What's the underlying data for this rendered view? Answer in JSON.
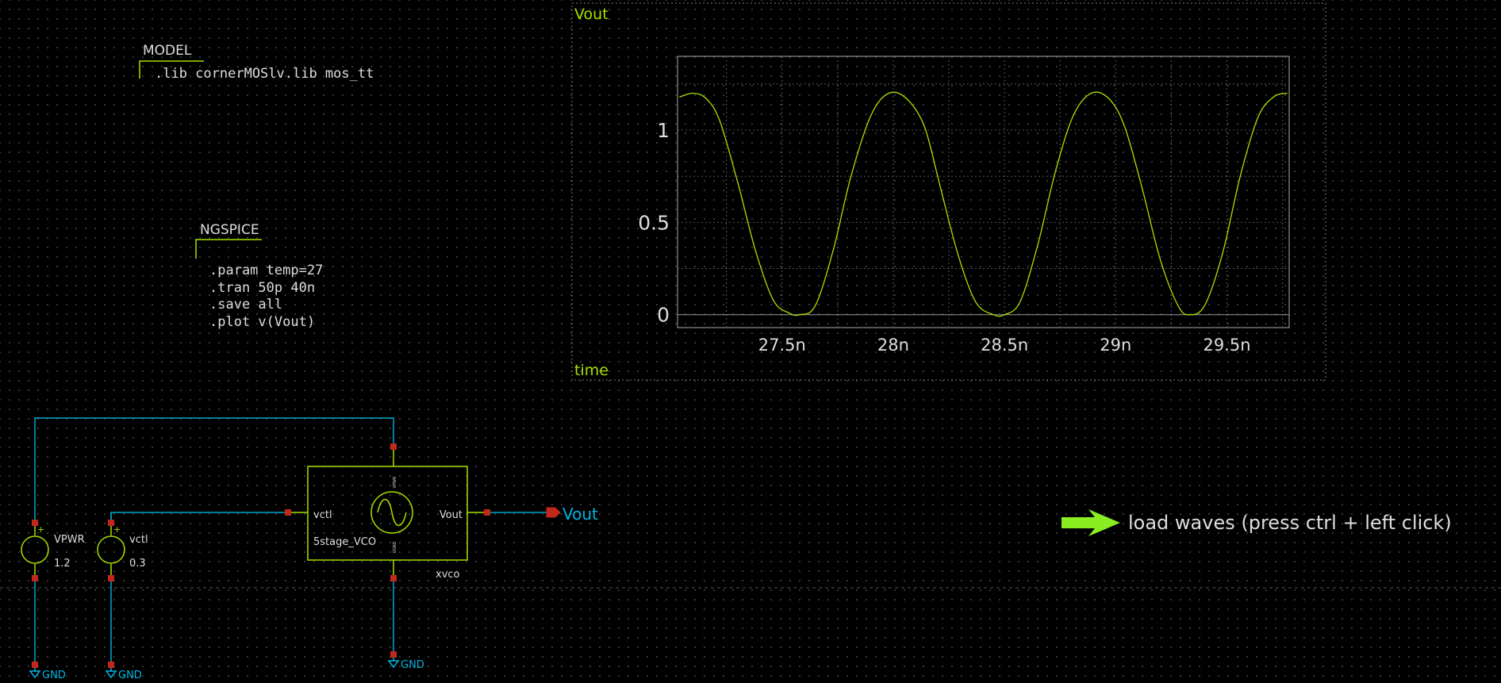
{
  "model_block": {
    "title": "MODEL",
    "lines": [
      ".lib cornerMOSlv.lib mos_tt"
    ]
  },
  "ngspice_block": {
    "title": "NGSPICE",
    "lines": [
      ".param temp=27",
      ".tran 50p 40n",
      ".save all",
      ".plot v(Vout)"
    ]
  },
  "graph": {
    "signal_label": "Vout",
    "x_label": "time",
    "y_ticks": [
      "1",
      "0.5",
      "0"
    ],
    "x_ticks": [
      "27.5n",
      "28n",
      "28.5n",
      "29n",
      "29.5n"
    ]
  },
  "chart_data": {
    "type": "line",
    "title": "",
    "xlabel": "time",
    "ylabel": "Vout",
    "xlim": [
      27.03,
      29.78
    ],
    "ylim": [
      -0.07,
      1.4
    ],
    "y_tick_values": [
      0,
      0.5,
      1
    ],
    "x_tick_values": [
      27.5,
      28.0,
      28.5,
      29.0,
      29.5
    ],
    "x_units": "ns",
    "grid": true,
    "series": [
      {
        "name": "Vout",
        "color": "#a8e000",
        "x": [
          27.04,
          27.1,
          27.16,
          27.22,
          27.3,
          27.38,
          27.46,
          27.53,
          27.58,
          27.65,
          27.73,
          27.81,
          27.9,
          27.98,
          28.06,
          28.14,
          28.21,
          28.29,
          28.37,
          28.45,
          28.5,
          28.57,
          28.65,
          28.73,
          28.81,
          28.89,
          28.97,
          29.04,
          29.12,
          29.2,
          29.28,
          29.33,
          29.4,
          29.48,
          29.56,
          29.64,
          29.71,
          29.77
        ],
        "y": [
          1.18,
          1.2,
          1.17,
          1.05,
          0.72,
          0.35,
          0.08,
          0.01,
          0.0,
          0.05,
          0.35,
          0.75,
          1.08,
          1.2,
          1.17,
          1.02,
          0.7,
          0.33,
          0.07,
          0.0,
          0.0,
          0.07,
          0.38,
          0.78,
          1.08,
          1.2,
          1.17,
          1.02,
          0.68,
          0.3,
          0.05,
          0.0,
          0.05,
          0.33,
          0.75,
          1.07,
          1.18,
          1.2
        ]
      }
    ]
  },
  "circuit": {
    "vpwr": {
      "name": "VPWR",
      "value": "1.2"
    },
    "vctl": {
      "name": "vctl",
      "value": "0.3"
    },
    "vco": {
      "symbol": "5stage_VCO",
      "instance": "xvco",
      "pin_in": "vctl",
      "pin_out": "Vout",
      "pin_top": "VPWR",
      "pin_bottom": "VGND"
    },
    "out_label": "Vout",
    "gnd_labels": [
      "GND",
      "GND",
      "GND"
    ]
  },
  "load_waves": {
    "text": "load waves (press ctrl + left click)",
    "icon": "arrow-right-icon"
  },
  "colors": {
    "wire": "#00a8cc",
    "component": "#a8e000",
    "pin": "#c0281c",
    "net_label": "#00b4e0",
    "text": "#dddddd"
  }
}
